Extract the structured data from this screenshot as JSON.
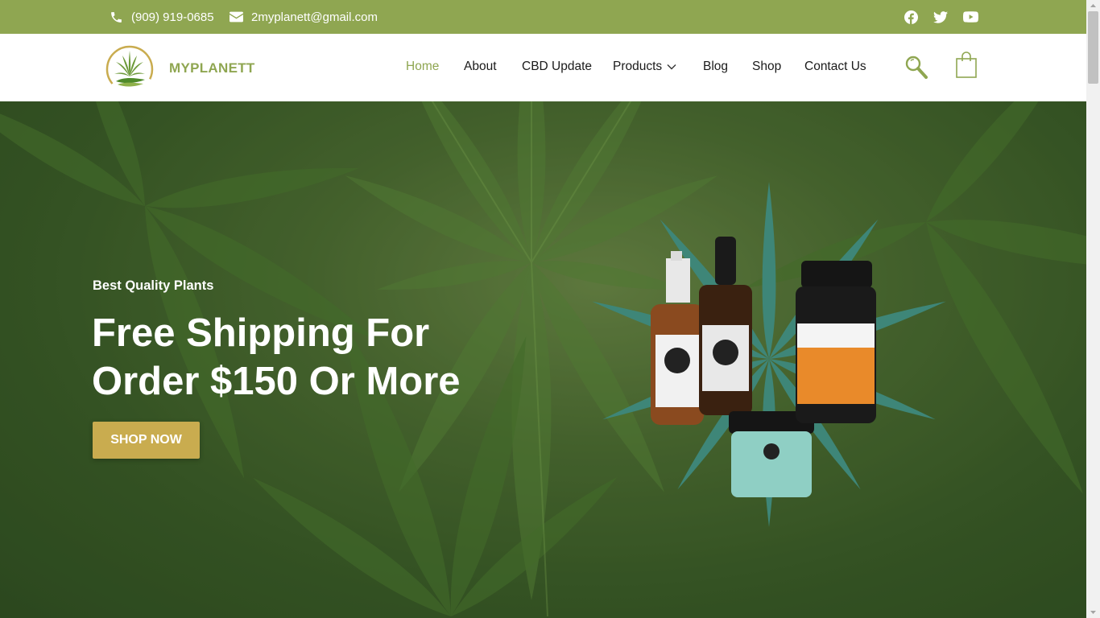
{
  "topbar": {
    "phone": "(909) 919-0685",
    "email": "2myplanett@gmail.com",
    "social": [
      "facebook-icon",
      "twitter-icon",
      "youtube-icon"
    ],
    "bg_color": "#8fa651"
  },
  "header": {
    "brand": "MYPLANETT",
    "nav": {
      "home": "Home",
      "about": "About",
      "cbd_update": "CBD Update",
      "products": "Products",
      "blog": "Blog",
      "shop": "Shop",
      "contact": "Contact Us"
    },
    "active_nav": "Home",
    "accent_color": "#8fa651"
  },
  "hero": {
    "subtitle": "Best Quality Plants",
    "title": "Free Shipping For Order $150 Or More",
    "button": "SHOP NOW",
    "button_color": "#c9ac4f"
  }
}
